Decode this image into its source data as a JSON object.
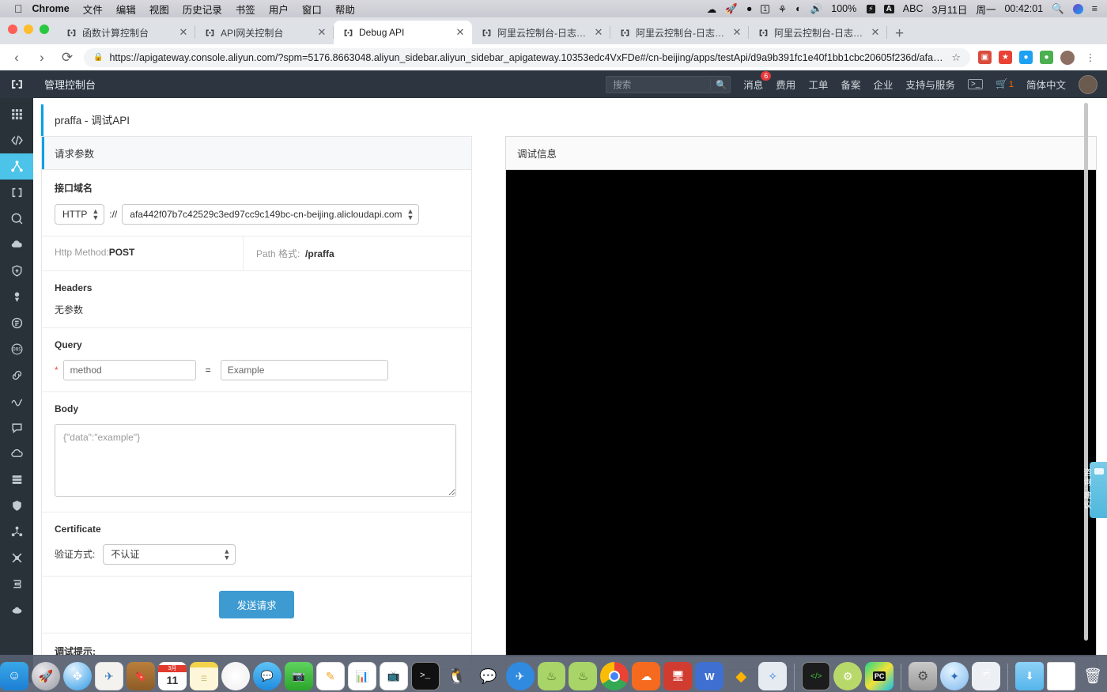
{
  "menubar": {
    "apple": "",
    "app": "Chrome",
    "items": [
      "文件",
      "编辑",
      "视图",
      "历史记录",
      "书签",
      "用户",
      "窗口",
      "帮助"
    ],
    "status": {
      "battery_percent": "100%",
      "input_source_badge": "A",
      "input_source": "ABC",
      "date": "3月11日",
      "weekday": "周一",
      "time": "00:42:01"
    },
    "status_icons": [
      "dropbox-icon",
      "rocket-icon",
      "shield-icon",
      "calendar-day-icon",
      "bluetooth-icon",
      "wifi-icon",
      "volume-icon",
      "battery-icon",
      "search-icon",
      "siri-icon",
      "notification-center-icon"
    ]
  },
  "browser": {
    "tabs": [
      {
        "title": "函数计算控制台",
        "active": false
      },
      {
        "title": "API网关控制台",
        "active": false
      },
      {
        "title": "Debug API",
        "active": true
      },
      {
        "title": "阿里云控制台-日志服务",
        "active": false
      },
      {
        "title": "阿里云控制台-日志服务",
        "active": false
      },
      {
        "title": "阿里云控制台-日志服务",
        "active": false
      }
    ],
    "new_tab_label": "+",
    "close_label": "✕",
    "nav": {
      "back": "‹",
      "forward": "›",
      "reload": "⟳"
    },
    "url": "https://apigateway.console.aliyun.com/?spm=5176.8663048.aliyun_sidebar.aliyun_sidebar_apigateway.10353edc4VxFDe#/cn-beijing/apps/testApi/d9a9b391fc1e40f1bb1cbc20605f236d/afa4…",
    "star": "☆",
    "lock_icon": "🔒"
  },
  "ali_header": {
    "title": "管理控制台",
    "search_placeholder": "搜索",
    "nav": [
      {
        "label": "消息",
        "badge": "6"
      },
      {
        "label": "费用",
        "badge": ""
      },
      {
        "label": "工单",
        "badge": ""
      },
      {
        "label": "备案",
        "badge": ""
      },
      {
        "label": "企业",
        "badge": ""
      },
      {
        "label": "支持与服务",
        "badge": ""
      }
    ],
    "cart_count": "1",
    "language": "简体中文"
  },
  "sidebar": {
    "icons": [
      {
        "name": "apps-grid-icon",
        "active": false
      },
      {
        "name": "code-icon",
        "active": false
      },
      {
        "name": "api-gateway-icon",
        "active": true
      },
      {
        "name": "container-icon",
        "active": false
      },
      {
        "name": "search-circle-icon",
        "active": false
      },
      {
        "name": "cloud-monitor-icon",
        "active": false
      },
      {
        "name": "security-shield-icon",
        "active": false
      },
      {
        "name": "push-icon",
        "active": false
      },
      {
        "name": "message-service-icon",
        "active": false
      },
      {
        "name": "dns-icon",
        "active": false
      },
      {
        "name": "link-icon",
        "active": false
      },
      {
        "name": "analytics-icon",
        "active": false
      },
      {
        "name": "chat-icon",
        "active": false
      },
      {
        "name": "cloud-icon",
        "active": false
      },
      {
        "name": "database-icon",
        "active": false
      },
      {
        "name": "shield-alt-icon",
        "active": false
      },
      {
        "name": "network-icon",
        "active": false
      },
      {
        "name": "cluster-icon",
        "active": false
      },
      {
        "name": "storage-icon",
        "active": false
      },
      {
        "name": "disk-icon",
        "active": false
      }
    ]
  },
  "page": {
    "title": "praffa - 调试API",
    "request_panel": {
      "header": "请求参数",
      "domain": {
        "label": "接口域名",
        "protocol": "HTTP",
        "separator": "://",
        "host": "afa442f07b7c42529c3ed97cc9c149bc-cn-beijing.alicloudapi.com"
      },
      "method": {
        "label": "Http Method:",
        "value": "POST"
      },
      "path": {
        "label": "Path 格式:",
        "value": "/praffa"
      },
      "headers": {
        "label": "Headers",
        "empty": "无参数"
      },
      "query": {
        "label": "Query",
        "required_mark": "*",
        "key_placeholder": "method",
        "equals": "=",
        "value_placeholder": "Example"
      },
      "body": {
        "label": "Body",
        "placeholder": "{\"data\":\"example\"}"
      },
      "certificate": {
        "label": "Certificate",
        "field_label": "验证方式:",
        "value": "不认证"
      },
      "send_button": "发送请求",
      "debug_tip": "调试提示:"
    },
    "debug_panel": {
      "header": "调试信息",
      "body": ""
    },
    "consult_widget": "咨询·建议"
  },
  "dock": {
    "items": [
      {
        "name": "finder",
        "running": true
      },
      {
        "name": "launchpad",
        "running": false
      },
      {
        "name": "safari",
        "running": true
      },
      {
        "name": "mail",
        "running": false
      },
      {
        "name": "contacts",
        "running": false
      },
      {
        "name": "calendar",
        "running": false
      },
      {
        "name": "notes",
        "running": false
      },
      {
        "name": "photos",
        "running": false
      },
      {
        "name": "messages",
        "running": false
      },
      {
        "name": "facetime",
        "running": false
      },
      {
        "name": "pages",
        "running": false
      },
      {
        "name": "numbers",
        "running": false
      },
      {
        "name": "keynote",
        "running": false
      },
      {
        "name": "terminal",
        "running": true
      },
      {
        "name": "qq",
        "running": false
      },
      {
        "name": "wechat",
        "running": true
      },
      {
        "name": "dingtalk",
        "running": true
      },
      {
        "name": "youdao",
        "running": false
      },
      {
        "name": "youdao-note",
        "running": false
      },
      {
        "name": "chrome",
        "running": true
      },
      {
        "name": "aliwangwang",
        "running": true
      },
      {
        "name": "teamviewer",
        "running": false
      },
      {
        "name": "wps",
        "running": false
      },
      {
        "name": "sketch",
        "running": false
      },
      {
        "name": "app-store",
        "running": false
      },
      {
        "name": "iterm",
        "running": false
      },
      {
        "name": "android-studio",
        "running": false
      },
      {
        "name": "pycharm",
        "running": true
      },
      {
        "name": "system-preferences",
        "running": false
      },
      {
        "name": "wechat-devtools",
        "running": false
      },
      {
        "name": "preview",
        "running": false
      },
      {
        "name": "downloads-folder",
        "running": false
      },
      {
        "name": "document",
        "running": false
      },
      {
        "name": "trash",
        "running": false
      }
    ],
    "calendar_day": "11",
    "calendar_month": "3月",
    "pycharm_label": "PC"
  }
}
